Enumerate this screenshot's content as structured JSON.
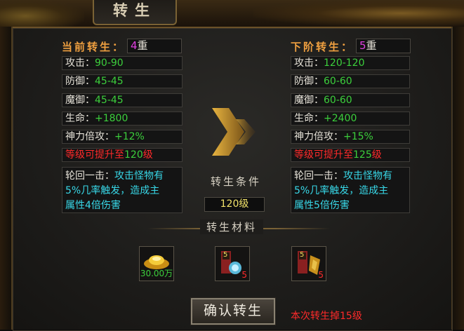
{
  "window": {
    "title": "转生"
  },
  "current": {
    "header": "当前转生：",
    "level_num": "4",
    "level_unit": "重",
    "stats": [
      {
        "label": "攻击：",
        "value": "90-90"
      },
      {
        "label": "防御：",
        "value": "45-45"
      },
      {
        "label": "魔御：",
        "value": "45-45"
      },
      {
        "label": "生命：",
        "value": "+1800"
      },
      {
        "label": "神力倍攻：",
        "value": "+12%"
      }
    ],
    "cap_prefix": "等级可提升至",
    "cap_value": "120",
    "cap_suffix": "级",
    "skill_name": "轮回一击：",
    "skill_desc": "攻击怪物有5%几率触发，造成主属性4倍伤害",
    "skill_line1": "攻击怪物有",
    "skill_line2": "5%几率触发，造成主",
    "skill_line3": "属性4倍伤害"
  },
  "next": {
    "header": "下阶转生：",
    "level_num": "5",
    "level_unit": "重",
    "stats": [
      {
        "label": "攻击：",
        "value": "120-120"
      },
      {
        "label": "防御：",
        "value": "60-60"
      },
      {
        "label": "魔御：",
        "value": "60-60"
      },
      {
        "label": "生命：",
        "value": "+2400"
      },
      {
        "label": "神力倍攻：",
        "value": "+15%"
      }
    ],
    "cap_prefix": "等级可提升至",
    "cap_value": "125",
    "cap_suffix": "级",
    "skill_name": "轮回一击：",
    "skill_line1": "攻击怪物有",
    "skill_line2": "5%几率触发，造成主",
    "skill_line3": "属性5倍伤害"
  },
  "condition": {
    "label": "转生条件",
    "value": "120级"
  },
  "materials": {
    "label": "转生材料",
    "items": [
      {
        "icon": "gold-ingot-icon",
        "amount": "30.00万"
      },
      {
        "icon": "rebirth-book-icon",
        "badge": "5",
        "quantity": "5"
      },
      {
        "icon": "rebirth-scroll-icon",
        "badge": "5",
        "quantity": "5"
      }
    ]
  },
  "confirm_label": "确认转生",
  "notice": "本次转生掉15级",
  "colors": {
    "accent_orange": "#f0a040",
    "stat_green": "#3ccf3c",
    "warn_red": "#ff2a2a",
    "skill_cyan": "#38d8e8",
    "level_magenta": "#e040e0"
  }
}
